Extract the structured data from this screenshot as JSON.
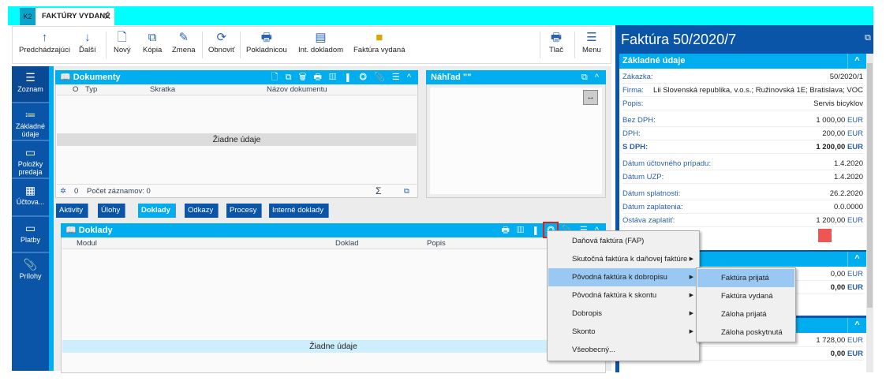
{
  "app": {
    "logo": "K2",
    "tab_title": "FAKTÚRY VYDANÉ",
    "close": "✕"
  },
  "toolbar": {
    "prev": "Predchádzajúci",
    "next": "Ďalší",
    "new": "Nový",
    "copy": "Kópia",
    "edit": "Zmena",
    "refresh": "Obnoviť",
    "cash": "Pokladnicou",
    "int_doc": "Int. dokladom",
    "invoice": "Faktúra vydaná",
    "print": "Tlač",
    "menu": "Menu"
  },
  "sidebar": [
    {
      "label": "Zoznam"
    },
    {
      "label": "Základné údaje"
    },
    {
      "label": "Položky predaja"
    },
    {
      "label": "Účtova..."
    },
    {
      "label": "Platby"
    },
    {
      "label": "Prílohy"
    }
  ],
  "documents": {
    "title": "Dokumenty",
    "columns": [
      "O",
      "Typ",
      "Skratka",
      "Názov dokumentu"
    ],
    "empty": "Žiadne údaje",
    "count": "0",
    "count_label": "Počet záznamov: 0",
    "sum": "Σ"
  },
  "preview": {
    "title": "Náhľad \"\""
  },
  "tabs": [
    "Aktivity",
    "Úlohy",
    "Doklady",
    "Odkazy",
    "Procesy",
    "Interné doklady"
  ],
  "doklady": {
    "title": "Doklady",
    "columns": [
      "Modul",
      "Doklad",
      "Popis"
    ],
    "empty": "Žiadne údaje"
  },
  "context_menu": [
    {
      "label": "Daňová faktúra (FAP)",
      "sub": false
    },
    {
      "label": "Skutočná faktúra k daňovej faktúre",
      "sub": true
    },
    {
      "label": "Pôvodná faktúra k dobropisu",
      "sub": true,
      "highlight": true
    },
    {
      "label": "Pôvodná faktúra k skontu",
      "sub": true
    },
    {
      "label": "Dobropis",
      "sub": true
    },
    {
      "label": "Skonto",
      "sub": true
    },
    {
      "label": "Všeobecný...",
      "sub": false
    }
  ],
  "submenu": [
    {
      "label": "Faktúra prijatá"
    },
    {
      "label": "Faktúra vydaná"
    },
    {
      "label": "Záloha prijatá"
    },
    {
      "label": "Záloha poskytnutá"
    }
  ],
  "detail": {
    "title": "Faktúra 50/2020/7",
    "section": "Základné údaje",
    "zakazka_l": "Zákazka:",
    "zakazka": "50/2020/1",
    "firma_l": "Firma:",
    "firma": "Lii Slovenská republika, v.o.s.; Ružinovská 1E; Bratislava; VOC",
    "popis_l": "Popis:",
    "popis": "Servis bicyklov",
    "bez_l": "Bez DPH:",
    "bez": "1 000,00",
    "dph_l": "DPH:",
    "dph": "200,00",
    "sdph_l": "S DPH:",
    "sdph": "1 200,00",
    "cur": "EUR",
    "d_uct_l": "Dátum účtovného prípadu:",
    "d_uct": "1.4.2020",
    "d_uzp_l": "Dátum UZP:",
    "d_uzp": "1.4.2020",
    "d_spl_l": "Dátum splatnosti:",
    "d_spl": "26.2.2020",
    "d_zap_l": "Dátum zaplatenia:",
    "d_zap": "0.0.0000",
    "ostava_l": "Ostáva zaplatiť:",
    "ostava": "1 200,00",
    "status_color": "#f05555",
    "s2_a": "0,00",
    "s2_b": "0,00",
    "s3_a": "1 728,00",
    "s3_b": "0,00"
  }
}
